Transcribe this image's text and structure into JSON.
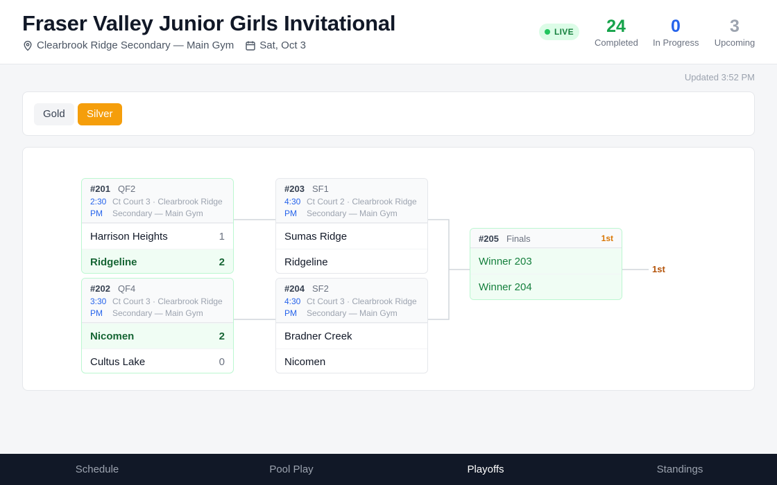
{
  "header": {
    "title": "Fraser Valley Junior Girls Invitational",
    "venue": "Clearbrook Ridge Secondary — Main Gym",
    "date": "Sat, Oct 3",
    "live_label": "LIVE",
    "stats": [
      {
        "value": "24",
        "label": "Completed",
        "color": "#16a34a"
      },
      {
        "value": "0",
        "label": "In Progress",
        "color": "#2563eb"
      },
      {
        "value": "3",
        "label": "Upcoming",
        "color": "#9ca3af"
      }
    ]
  },
  "updated": "Updated 3:52 PM",
  "tabs": [
    {
      "label": "Gold",
      "active": false
    },
    {
      "label": "Silver",
      "active": true
    }
  ],
  "bracket": {
    "m201": {
      "num": "#201",
      "round": "QF2",
      "time": "2:30 PM",
      "court": "Ct Court 3 · Clearbrook Ridge Secondary — Main Gym",
      "teams": [
        {
          "name": "Harrison Heights",
          "score": "1"
        },
        {
          "name": "Ridgeline",
          "score": "2"
        }
      ]
    },
    "m202": {
      "num": "#202",
      "round": "QF4",
      "time": "3:30 PM",
      "court": "Ct Court 3 · Clearbrook Ridge Secondary — Main Gym",
      "teams": [
        {
          "name": "Nicomen",
          "score": "2"
        },
        {
          "name": "Cultus Lake",
          "score": "0"
        }
      ]
    },
    "m203": {
      "num": "#203",
      "round": "SF1",
      "time": "4:30 PM",
      "court": "Ct Court 2 · Clearbrook Ridge Secondary — Main Gym",
      "teams": [
        {
          "name": "Sumas Ridge",
          "score": ""
        },
        {
          "name": "Ridgeline",
          "score": ""
        }
      ]
    },
    "m204": {
      "num": "#204",
      "round": "SF2",
      "time": "4:30 PM",
      "court": "Ct Court 3 · Clearbrook Ridge Secondary — Main Gym",
      "teams": [
        {
          "name": "Bradner Creek",
          "score": ""
        },
        {
          "name": "Nicomen",
          "score": ""
        }
      ]
    },
    "m205": {
      "num": "#205",
      "round": "Finals",
      "place": "1st",
      "teams": [
        {
          "name": "Winner 203"
        },
        {
          "name": "Winner 204"
        }
      ]
    },
    "final_place": "1st"
  },
  "nav": [
    {
      "label": "Schedule"
    },
    {
      "label": "Pool Play"
    },
    {
      "label": "Playoffs"
    },
    {
      "label": "Standings"
    }
  ]
}
